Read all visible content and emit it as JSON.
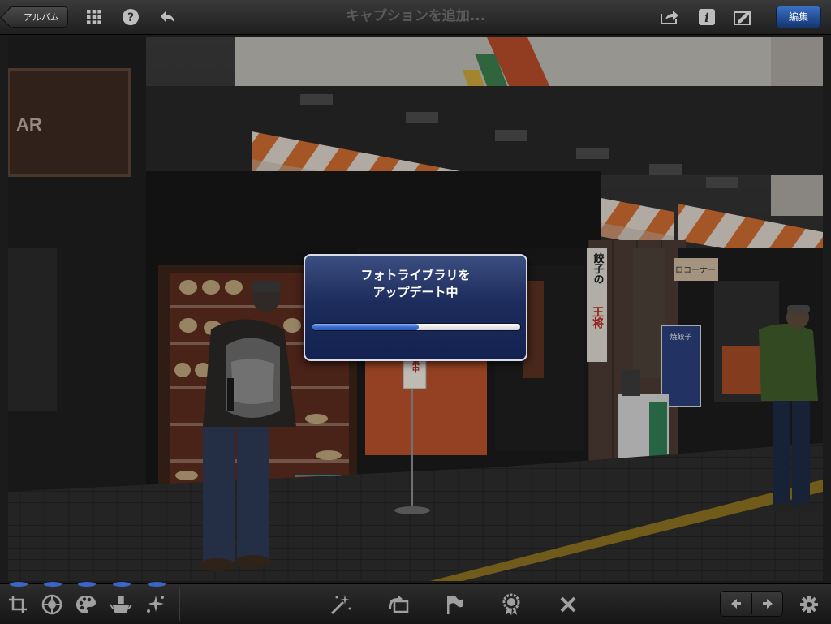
{
  "toolbar": {
    "back_label": "アルバム",
    "caption_placeholder": "キャプションを追加...",
    "edit_label": "編集",
    "icons": [
      "grid-icon",
      "help-icon",
      "undo-icon",
      "share-icon",
      "info-icon",
      "notes-icon"
    ]
  },
  "photo": {
    "sign_text": "王将",
    "vertical_sign": "餃子の",
    "corner_sign": "ロコーナー",
    "stand_sign": "営業中",
    "poster_text": "焼餃子"
  },
  "dialog": {
    "title_line1": "フォトライブラリを",
    "title_line2": "アップデート中",
    "progress": 0.51
  },
  "bottom": {
    "left_tools": [
      "crop-icon",
      "exposure-icon",
      "color-palette-icon",
      "brush-icon",
      "effects-icon"
    ],
    "center_tools": [
      "auto-enhance-icon",
      "rotate-icon",
      "flag-icon",
      "favorite-icon",
      "reject-icon"
    ],
    "nav": [
      "previous-icon",
      "next-icon"
    ],
    "settings": "gear-icon"
  },
  "colors": {
    "accent": "#2e5fc0",
    "dialog": "#1c2c5c"
  }
}
